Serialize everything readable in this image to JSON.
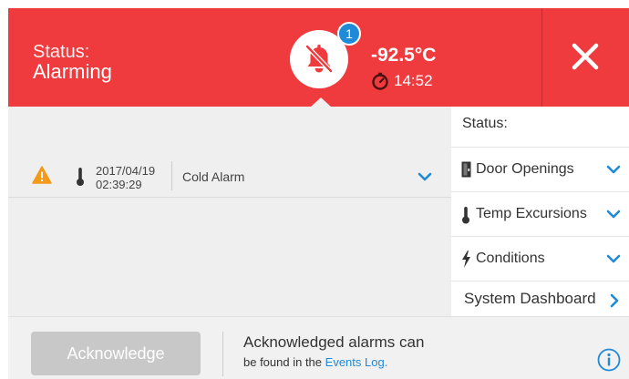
{
  "header": {
    "status_label": "Status:",
    "status_value": "Alarming",
    "alarm_count": "1",
    "temperature": "-92.5°C",
    "timer": "14:52",
    "icons": {
      "bell": "bell-muted-icon",
      "timer": "timer-icon",
      "close": "close-icon"
    },
    "colors": {
      "background": "#ef3a3e",
      "badge": "#1f8ad8"
    }
  },
  "alarms": [
    {
      "date": "2017/04/19",
      "time": "02:39:29",
      "type": "Cold Alarm",
      "icons": {
        "severity": "warning-triangle-icon",
        "source": "thermometer-icon",
        "expand": "chevron-down-icon"
      }
    }
  ],
  "side_panel": {
    "title": "Status:",
    "items": [
      {
        "label": "Door Openings",
        "icon": "door-icon"
      },
      {
        "label": "Temp Excursions",
        "icon": "thermometer-icon"
      },
      {
        "label": "Conditions",
        "icon": "lightning-icon"
      }
    ],
    "dashboard_label": "System Dashboard"
  },
  "footer": {
    "acknowledge_label": "Acknowledge",
    "message_line1": "Acknowledged alarms can",
    "message_prefix": "be found in the",
    "events_log_link": "Events Log.",
    "info_icon": "info-icon"
  },
  "colors": {
    "accent": "#1f8ad8",
    "warning": "#f39a1b",
    "disabled_button": "#c8c8c8"
  }
}
